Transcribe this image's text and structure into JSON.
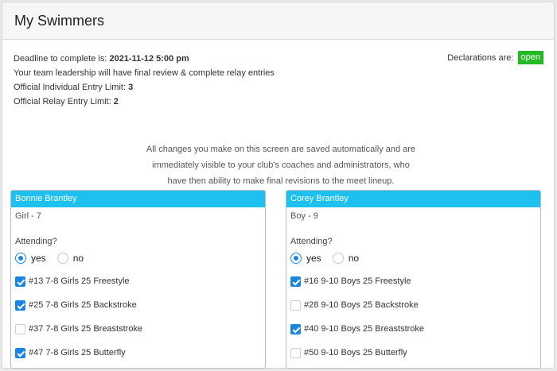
{
  "header": {
    "title": "My Swimmers"
  },
  "info": {
    "deadline_label": "Deadline to complete is:",
    "deadline_value": "2021-11-12 5:00 pm",
    "review_text": "Your team leadership will have final review & complete relay entries",
    "individual_label": "Official Individual Entry Limit:",
    "individual_value": "3",
    "relay_label": "Official Relay Entry Limit:",
    "relay_value": "2"
  },
  "declarations": {
    "label": "Declarations are:",
    "status": "open",
    "status_color": "#22bb22"
  },
  "notice": {
    "line1": "All changes you make on this screen are saved automatically and are",
    "line2": "immediately visible to your club's coaches and administrators, who",
    "line3": "have then ability to make final revisions to the meet lineup."
  },
  "accent_color": "#1dc0ef",
  "swimmers": [
    {
      "name": "Bonnie Brantley",
      "sub": "Girl - 7",
      "attending_label": "Attending?",
      "yes_label": "yes",
      "no_label": "no",
      "attending": "yes",
      "events": [
        {
          "label": "#13 7-8 Girls 25 Freestyle",
          "checked": true
        },
        {
          "label": "#25 7-8 Girls 25 Backstroke",
          "checked": true
        },
        {
          "label": "#37 7-8 Girls 25 Breaststroke",
          "checked": false
        },
        {
          "label": "#47 7-8 Girls 25 Butterfly",
          "checked": true
        }
      ]
    },
    {
      "name": "Corey Brantley",
      "sub": "Boy - 9",
      "attending_label": "Attending?",
      "yes_label": "yes",
      "no_label": "no",
      "attending": "yes",
      "events": [
        {
          "label": "#16 9-10 Boys 25 Freestyle",
          "checked": true
        },
        {
          "label": "#28 9-10 Boys 25 Backstroke",
          "checked": false
        },
        {
          "label": "#40 9-10 Boys 25 Breaststroke",
          "checked": true
        },
        {
          "label": "#50 9-10 Boys 25 Butterfly",
          "checked": false
        }
      ]
    }
  ]
}
